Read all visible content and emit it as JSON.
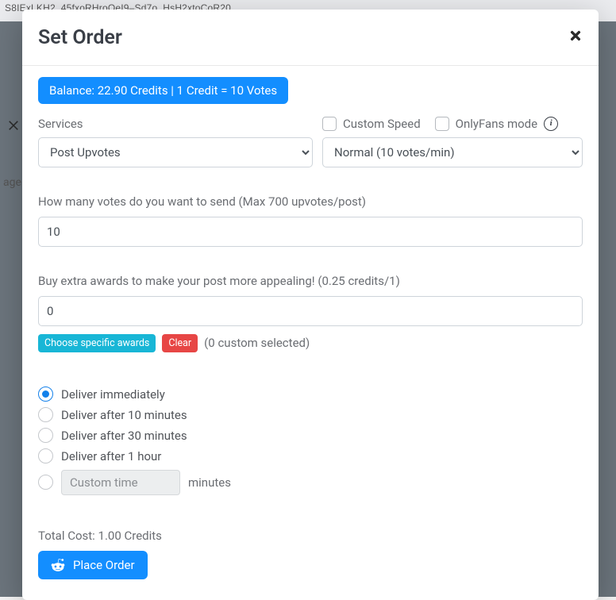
{
  "background": {
    "url_text": "S8IExLKH2_45fxoRHroQeI9–Sd7o_HsH2xtoCoR20",
    "age_text": "age"
  },
  "modal": {
    "title": "Set Order",
    "balance_badge": "Balance: 22.90 Credits | 1 Credit = 10 Votes",
    "services_label": "Services",
    "custom_speed_label": "Custom Speed",
    "onlyfans_label": "OnlyFans mode",
    "services_select_value": "Post Upvotes",
    "speed_select_value": "Normal (10 votes/min)",
    "votes_label": "How many votes do you want to send (Max 700 upvotes/post)",
    "votes_value": "10",
    "awards_label": "Buy extra awards to make your post more appealing! (0.25 credits/1)",
    "awards_value": "0",
    "choose_awards": "Choose specific awards",
    "clear": "Clear",
    "custom_selected": "(0 custom selected)",
    "deliver_options": {
      "o0": "Deliver immediately",
      "o1": "Deliver after 10 minutes",
      "o2": "Deliver after 30 minutes",
      "o3": "Deliver after 1 hour"
    },
    "custom_time_placeholder": "Custom time",
    "minutes_label": "minutes",
    "total_cost": "Total Cost: 1.00 Credits",
    "place_order": "Place Order"
  }
}
